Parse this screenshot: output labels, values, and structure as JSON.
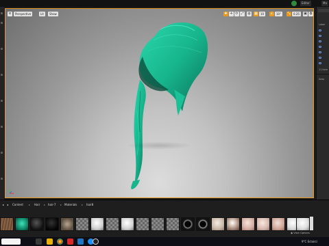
{
  "window": {
    "title_buttons": [
      "Editor",
      "Ma"
    ]
  },
  "viewport": {
    "menu_icon": "hamburger-icon",
    "view_mode_label": "Perspective",
    "lit_label": "Lit",
    "show_label": "Show",
    "camera_speed": "10°",
    "grid_size": "10",
    "snap_value": "0.25",
    "layout_value": "4",
    "selection_accent": "#e89a20"
  },
  "right_panel": {
    "label_a": "Label",
    "items_count": "11 item",
    "details_label": "Deta"
  },
  "content_browser": {
    "breadcrumbs": [
      "Content",
      "Hair",
      "hair-7",
      "Materials",
      "hair8"
    ],
    "view_options_label": "View Options"
  },
  "taskbar": {
    "tray_text": "9°C  Eclairci",
    "time": ""
  },
  "colors": {
    "hair": "#1fc39a",
    "hair_dark": "#0b6f58",
    "viewport_border": "#e89a20"
  }
}
